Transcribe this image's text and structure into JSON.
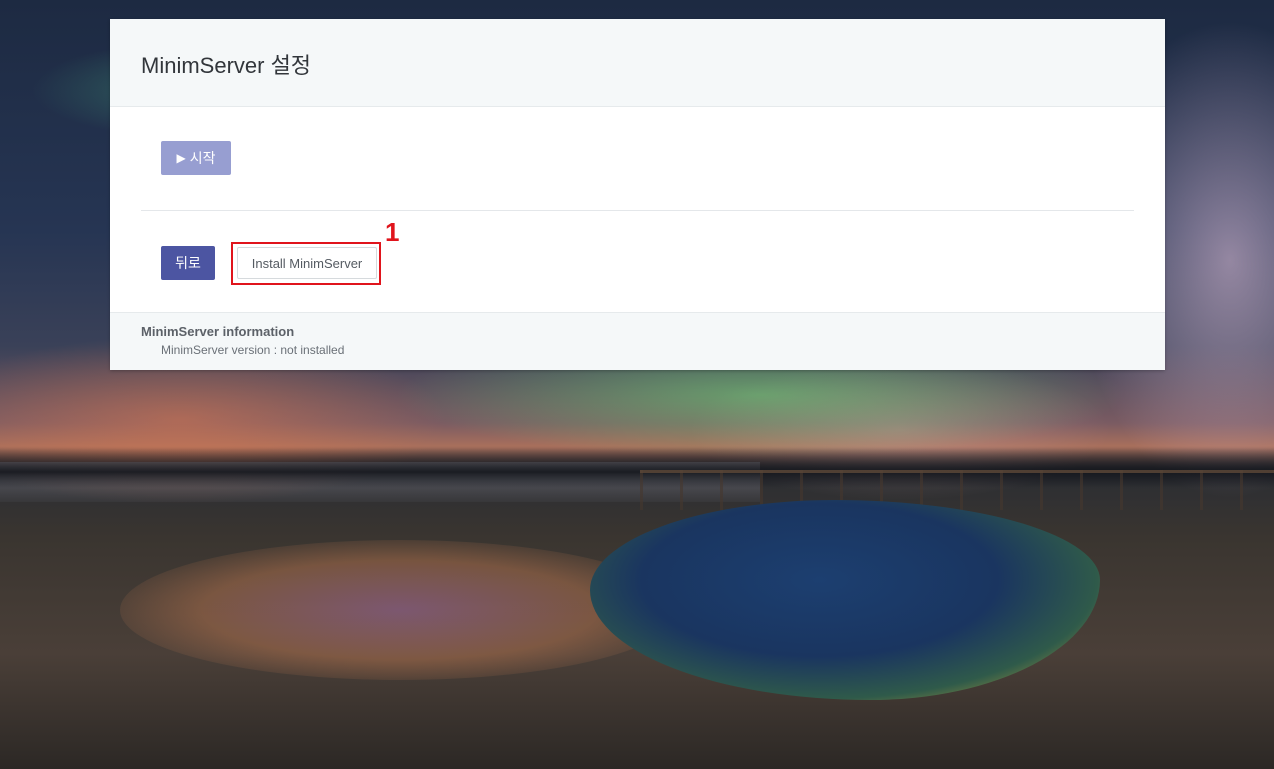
{
  "panel": {
    "title": "MinimServer 설정"
  },
  "controls": {
    "start_label": "시작",
    "start_icon": "play-icon",
    "back_label": "뒤로",
    "install_label": "Install MinimServer"
  },
  "annotation": {
    "number": "1",
    "color": "#e0141c"
  },
  "info": {
    "title": "MinimServer information",
    "version_line": "MinimServer version : not installed"
  },
  "colors": {
    "start_button": "#979ed1",
    "back_button": "#4c55a2",
    "panel_header": "#f5f8f9"
  }
}
